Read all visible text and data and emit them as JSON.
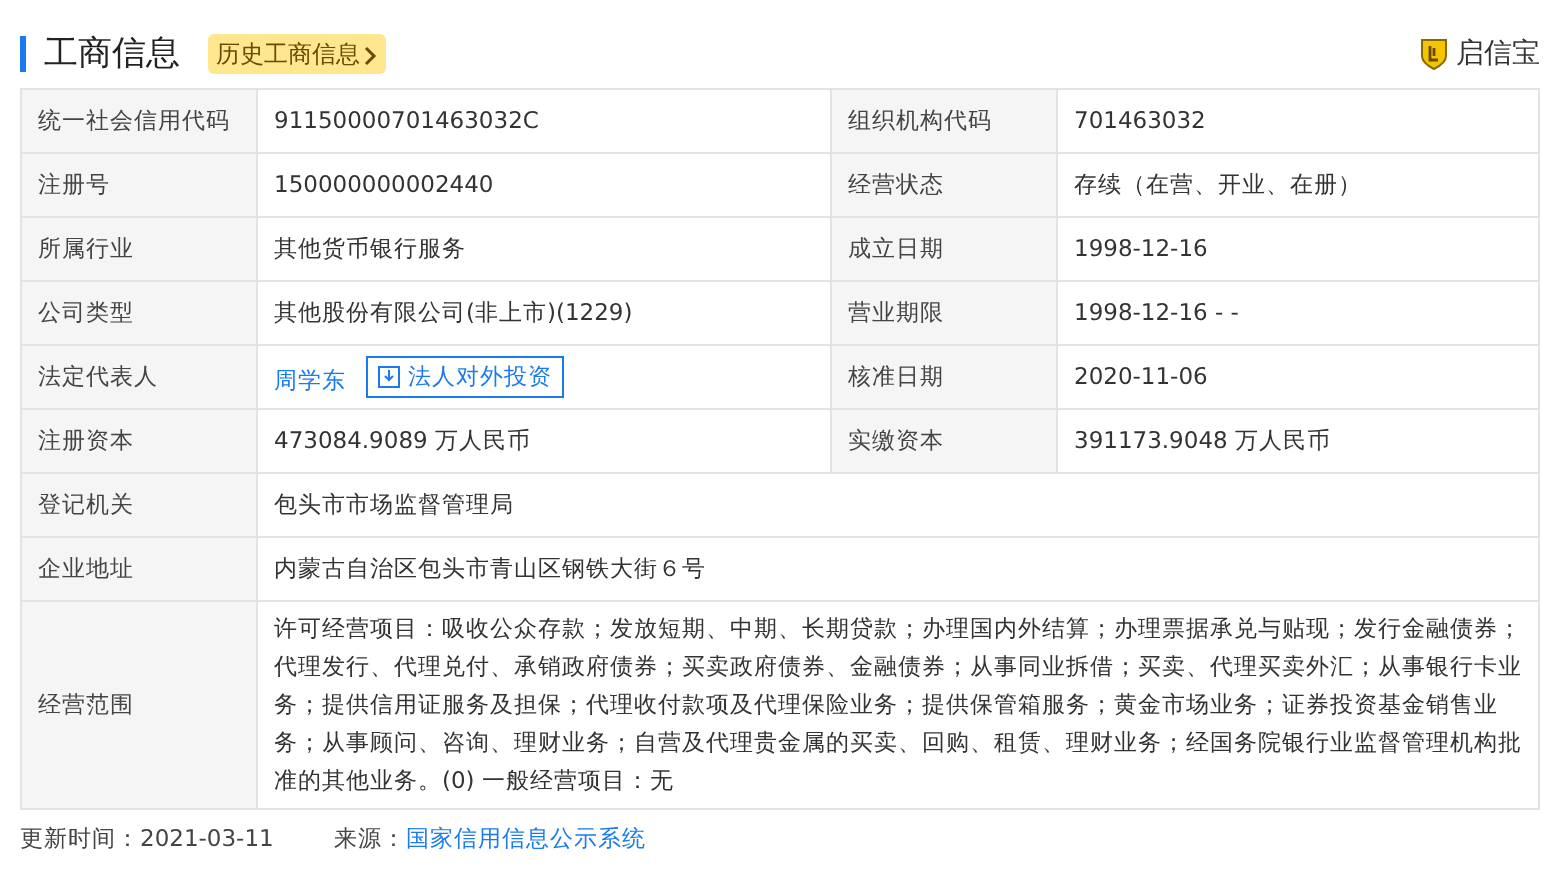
{
  "header": {
    "title": "工商信息",
    "history_link": "历史工商信息",
    "brand": "启信宝"
  },
  "rows": [
    {
      "kind": "pair",
      "cells": [
        {
          "label": "统一社会信用代码",
          "value": "91150000701463032C"
        },
        {
          "label": "组织机构代码",
          "value": "701463032"
        }
      ]
    },
    {
      "kind": "pair",
      "cells": [
        {
          "label": "注册号",
          "value": "150000000002440"
        },
        {
          "label": "经营状态",
          "value": "存续（在营、开业、在册）"
        }
      ]
    },
    {
      "kind": "pair",
      "cells": [
        {
          "label": "所属行业",
          "value": "其他货币银行服务"
        },
        {
          "label": "成立日期",
          "value": "1998-12-16"
        }
      ]
    },
    {
      "kind": "pair",
      "cells": [
        {
          "label": "公司类型",
          "value": "其他股份有限公司(非上市)(1229)"
        },
        {
          "label": "营业期限",
          "value": "1998-12-16 - -"
        }
      ]
    },
    {
      "kind": "representative",
      "cells": [
        {
          "label": "法定代表人",
          "value": "周学东",
          "action": "法人对外投资"
        },
        {
          "label": "核准日期",
          "value": "2020-11-06"
        }
      ]
    },
    {
      "kind": "pair",
      "cells": [
        {
          "label": "注册资本",
          "value": "473084.9089 万人民币"
        },
        {
          "label": "实缴资本",
          "value": "391173.9048 万人民币"
        }
      ]
    },
    {
      "kind": "single",
      "cells": [
        {
          "label": "登记机关",
          "value": "包头市市场监督管理局"
        }
      ]
    },
    {
      "kind": "single",
      "cells": [
        {
          "label": "企业地址",
          "value": "内蒙古自治区包头市青山区钢铁大街６号"
        }
      ]
    },
    {
      "kind": "single",
      "cells": [
        {
          "label": "经营范围",
          "value": "许可经营项目：吸收公众存款；发放短期、中期、长期贷款；办理国内外结算；办理票据承兑与贴现；发行金融债券；代理发行、代理兑付、承销政府债券；买卖政府债券、金融债券；从事同业拆借；买卖、代理买卖外汇；从事银行卡业务；提供信用证服务及担保；代理收付款项及代理保险业务；提供保管箱服务；黄金市场业务；证券投资基金销售业务；从事顾问、咨询、理财业务；自营及代理贵金属的买卖、回购、租赁、理财业务；经国务院银行业监督管理机构批准的其他业务。(0) 一般经营项目：无"
        }
      ]
    }
  ],
  "footer": {
    "updated_label": "更新时间：",
    "updated": "2021-03-11",
    "source_label": "来源：",
    "source": "国家信用信息公示系统"
  }
}
